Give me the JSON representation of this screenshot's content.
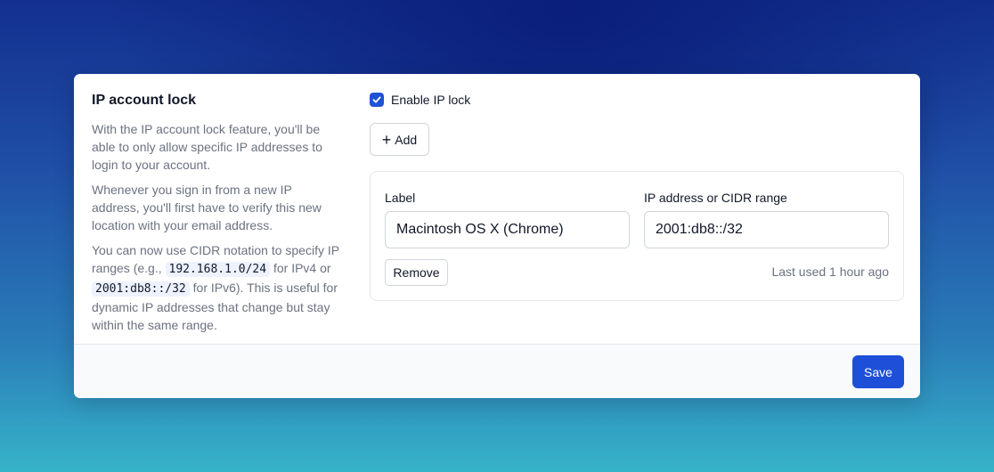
{
  "section": {
    "title": "IP account lock",
    "description_1": "With the IP account lock feature, you'll be able to only allow specific IP addresses to login to your account.",
    "description_2": "Whenever you sign in from a new IP address, you'll first have to verify this new location with your email address.",
    "description_3": {
      "part_1": "You can now use CIDR notation to specify IP ranges (e.g., ",
      "ipv4_example": "192.168.1.0/24",
      "part_2": " for IPv4 or ",
      "ipv6_example": "2001:db8::/32",
      "part_3": " for IPv6). This is useful for dynamic IP addresses that change but stay within the same range."
    }
  },
  "settings": {
    "enable_label": "Enable IP lock",
    "enabled": true,
    "add_label": "Add",
    "add_icon": "plus-icon"
  },
  "entries": [
    {
      "label_heading": "Label",
      "label_value": "Macintosh OS X (Chrome)",
      "ip_heading": "IP address or CIDR range",
      "ip_value": "2001:db8::/32",
      "remove_label": "Remove",
      "last_used": "Last used 1 hour ago"
    }
  ],
  "footer": {
    "save_label": "Save"
  },
  "colors": {
    "accent": "#1d4fd8",
    "muted_text": "#6b7280",
    "code_bg": "#eef2ff"
  }
}
